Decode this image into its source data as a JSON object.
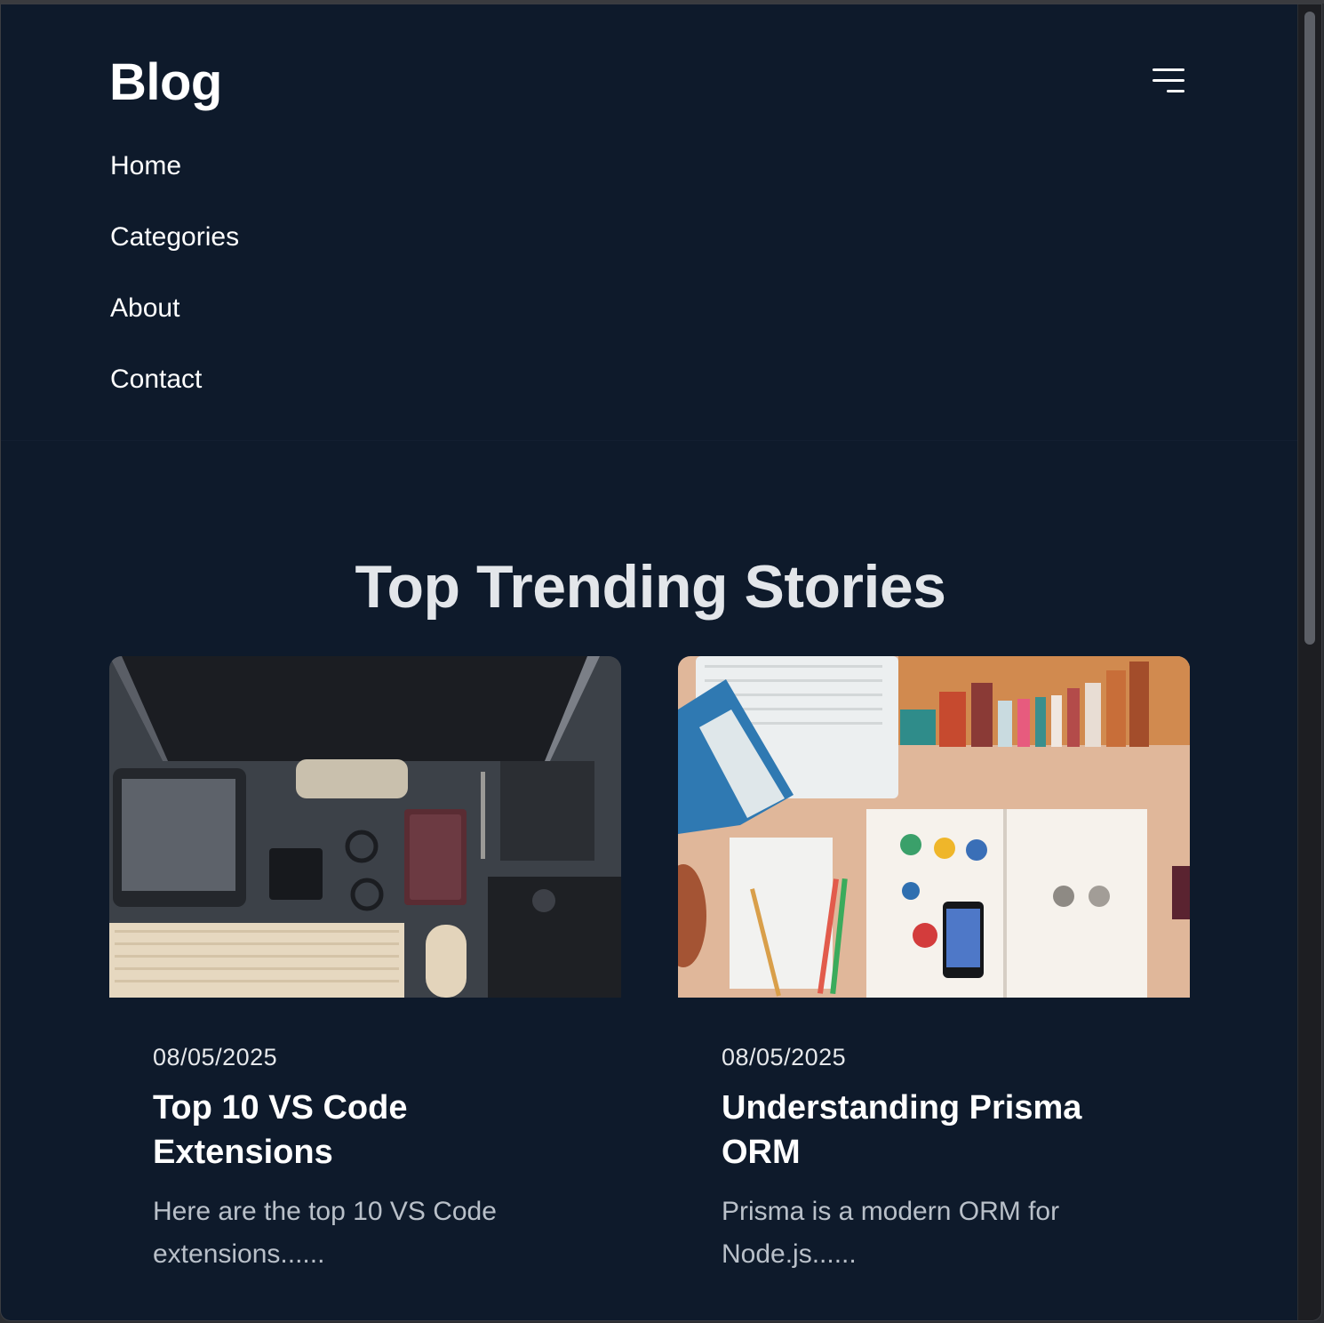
{
  "brand": "Blog",
  "nav": {
    "items": [
      {
        "label": "Home"
      },
      {
        "label": "Categories"
      },
      {
        "label": "About"
      },
      {
        "label": "Contact"
      }
    ]
  },
  "icons": {
    "menu": "menu-icon"
  },
  "section": {
    "title": "Top Trending Stories"
  },
  "posts": [
    {
      "date": "08/05/2025",
      "title": "Top 10 VS Code Extensions",
      "excerpt": "Here are the top 10 VS Code extensions......"
    },
    {
      "date": "08/05/2025",
      "title": "Understanding Prisma ORM",
      "excerpt": "Prisma is a modern ORM for Node.js......"
    }
  ],
  "colors": {
    "background": "#0e1a2b",
    "text": "#ffffff",
    "muted_text": "#b9c0c9"
  }
}
